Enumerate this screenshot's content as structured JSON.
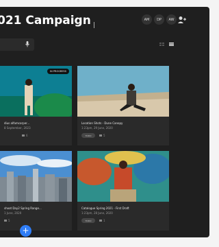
{
  "header": {
    "title": "021 Campaign",
    "collaborators": [
      "AM",
      "DP",
      "AW"
    ]
  },
  "icons": {
    "add_user": "add-user-icon",
    "mic": "mic-icon",
    "grid_view": "grid-view-icon",
    "list_view": "list-view-icon",
    "comment": "comment-icon",
    "add": "plus-icon"
  },
  "cards": [
    {
      "caption": "dius alfamcorper...",
      "date": "8 September, 2023",
      "badge": "IN PROGRESS",
      "status": "",
      "comments": "6"
    },
    {
      "caption": "Location Shots - Dune Canopy",
      "date": "1:23pm, 29 June, 2020",
      "badge": "",
      "status": "TODO",
      "comments": "5"
    },
    {
      "caption": "shoot Day2 Spring Range...",
      "date": "1 June, 2020",
      "badge": "",
      "status": "",
      "comments": "5"
    },
    {
      "caption": "Catalogue Spring 2021 - First Draft",
      "date": "1:23pm, 28 June, 2020",
      "badge": "",
      "status": "TODO",
      "comments": "1"
    }
  ],
  "colors": {
    "accent": "#2f7df6",
    "app_bg": "#1f1f1f",
    "card_bg": "#2a2a2a"
  }
}
